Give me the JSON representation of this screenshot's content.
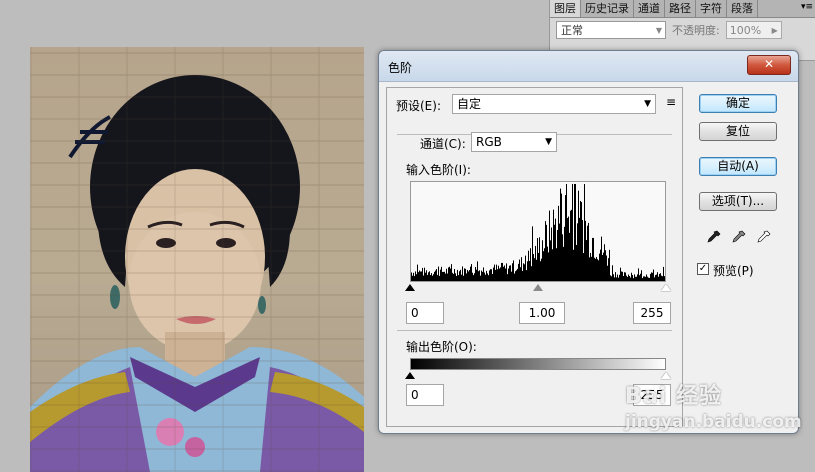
{
  "layers_panel": {
    "tabs": [
      {
        "label": "图层",
        "active": true
      },
      {
        "label": "历史记录",
        "active": false
      },
      {
        "label": "通道",
        "active": false
      },
      {
        "label": "路径",
        "active": false
      },
      {
        "label": "字符",
        "active": false
      },
      {
        "label": "段落",
        "active": false
      }
    ],
    "menu_icon": "▾≡",
    "blend_mode": "正常",
    "opacity_label": "不透明度:",
    "opacity_value": "100%"
  },
  "levels_dialog": {
    "title": "色阶",
    "close_label": "✕",
    "preset_label": "预设(E):",
    "preset_value": "自定",
    "channel_label": "通道(C):",
    "channel_value": "RGB",
    "input_levels_label": "输入色阶(I):",
    "input_black": "0",
    "input_gamma": "1.00",
    "input_white": "255",
    "output_levels_label": "输出色阶(O):",
    "output_black": "0",
    "output_white": "255",
    "buttons": {
      "ok": "确定",
      "reset": "复位",
      "auto": "自动(A)",
      "options": "选项(T)..."
    },
    "preview_label": "预览(P)",
    "preview_checked": true,
    "eyedroppers": [
      "black-eyedropper-icon",
      "gray-eyedropper-icon",
      "white-eyedropper-icon"
    ]
  },
  "watermark": {
    "text": "Bai 经验",
    "url": "jingyan.baidu.com"
  },
  "colors": {
    "dialog_bg": "#f0f0f0",
    "titlebar": "#c8d8ea",
    "close_red": "#c8432a",
    "default_button": "#bee6fd"
  }
}
